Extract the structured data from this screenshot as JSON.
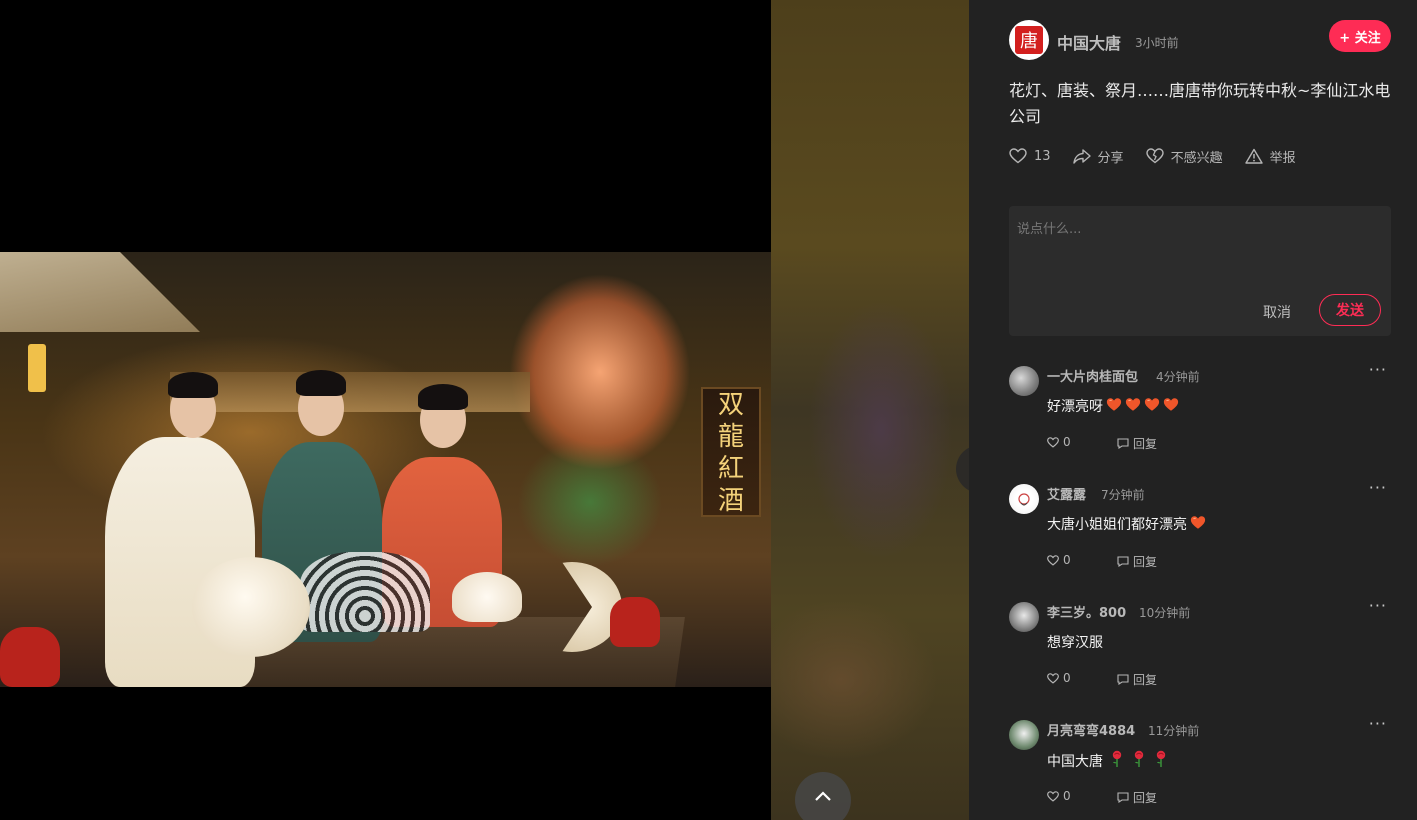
{
  "author": {
    "name": "中国大唐",
    "time": "3小时前",
    "follow_label": "+ 关注",
    "avatar_text": "唐"
  },
  "post": {
    "title": "花灯、唐装、祭月……唐唐带你玩转中秋~李仙江水电公司"
  },
  "actions": {
    "like_count": "13",
    "share_label": "分享",
    "not_interested_label": "不感兴趣",
    "report_label": "举报"
  },
  "comment_box": {
    "placeholder": "说点什么...",
    "cancel_label": "取消",
    "send_label": "发送"
  },
  "video": {
    "sign_text": [
      "双",
      "龍",
      "紅",
      "酒"
    ]
  },
  "comments": [
    {
      "user": "一大片肉桂面包",
      "time": "4分钟前",
      "text": "好漂亮呀",
      "emoji": "heart",
      "emoji_count": 4,
      "likes": "0",
      "reply_label": "回复"
    },
    {
      "user": "艾露露",
      "time": "7分钟前",
      "text": "大唐小姐姐们都好漂亮",
      "emoji": "heart",
      "emoji_count": 1,
      "likes": "0",
      "reply_label": "回复"
    },
    {
      "user": "李三岁。800",
      "time": "10分钟前",
      "text": "想穿汉服",
      "emoji": "",
      "emoji_count": 0,
      "likes": "0",
      "reply_label": "回复"
    },
    {
      "user": "月亮弯弯4884",
      "time": "11分钟前",
      "text": "中国大唐",
      "emoji": "rose",
      "emoji_count": 3,
      "likes": "0",
      "reply_label": "回复"
    }
  ],
  "colors": {
    "accent": "#fe2c55",
    "panel_bg": "#222222",
    "comment_box_bg": "#2c2c2c"
  },
  "icons": [
    "heart-icon",
    "share-icon",
    "broken-heart-icon",
    "warning-icon",
    "more-icon",
    "reply-icon",
    "chevron-right-icon",
    "chevron-up-icon"
  ]
}
